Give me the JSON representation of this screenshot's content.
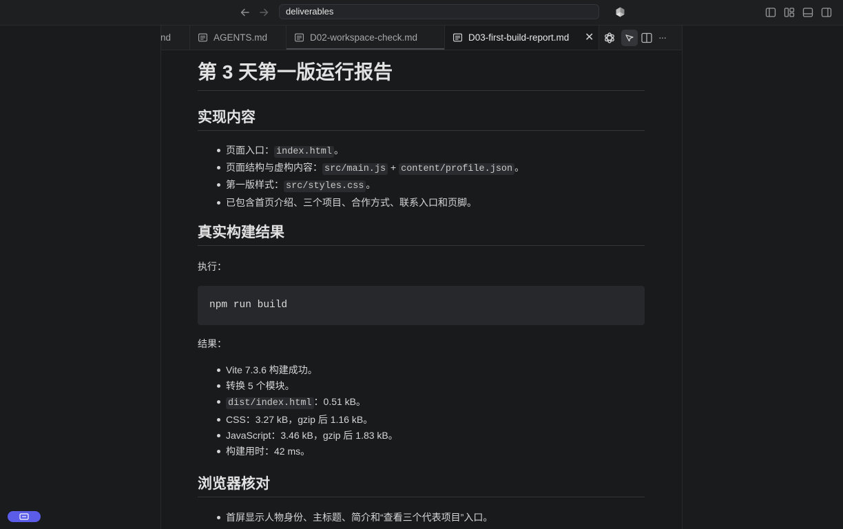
{
  "titlebar": {
    "address": "deliverables",
    "back_icon": "arrow-left-icon",
    "forward_icon": "arrow-right-icon",
    "logo_icon": "app-logo-icon",
    "layout_icons": [
      "sidebar-left-icon",
      "layout-grid-icon",
      "panel-bottom-icon",
      "sidebar-right-icon"
    ]
  },
  "tabs": [
    {
      "label": "nd",
      "active": false
    },
    {
      "label": "AGENTS.md",
      "active": false
    },
    {
      "label": "D02-workspace-check.md",
      "active": false
    },
    {
      "label": "D03-first-build-report.md",
      "active": true
    }
  ],
  "tab_close_glyph": "✕",
  "toolbar": {
    "more_glyph": "···",
    "icons": [
      "openai-icon",
      "pointer-icon",
      "split-editor-icon",
      "more-icon"
    ]
  },
  "doc": {
    "title": "第 3 天第一版运行报告",
    "section1": {
      "heading": "实现内容",
      "items": [
        {
          "pre": "页面入口：",
          "code1": "index.html",
          "mid": "",
          "code2": "",
          "post": "。"
        },
        {
          "pre": "页面结构与虚构内容：",
          "code1": "src/main.js",
          "mid": " + ",
          "code2": "content/profile.json",
          "post": "。"
        },
        {
          "pre": "第一版样式：",
          "code1": "src/styles.css",
          "mid": "",
          "code2": "",
          "post": "。"
        },
        {
          "pre": "已包含首页介绍、三个项目、合作方式、联系入口和页脚。",
          "code1": "",
          "mid": "",
          "code2": "",
          "post": ""
        }
      ]
    },
    "section2": {
      "heading": "真实构建结果",
      "exec_label": "执行：",
      "command": "npm run build",
      "result_label": "结果：",
      "items": [
        {
          "pre": "Vite 7.3.6 构建成功。",
          "code1": "",
          "post": ""
        },
        {
          "pre": "转换 5 个模块。",
          "code1": "",
          "post": ""
        },
        {
          "pre": "",
          "code1": "dist/index.html",
          "post": "：0.51 kB。"
        },
        {
          "pre": "CSS：3.27 kB，gzip 后 1.16 kB。",
          "code1": "",
          "post": ""
        },
        {
          "pre": "JavaScript：3.46 kB，gzip 后 1.83 kB。",
          "code1": "",
          "post": ""
        },
        {
          "pre": "构建用时：42 ms。",
          "code1": "",
          "post": ""
        }
      ]
    },
    "section3": {
      "heading": "浏览器核对",
      "items": [
        {
          "pre": "首屏显示人物身份、主标题、简介和“查看三个代表项目”入口。",
          "code1": "",
          "post": ""
        }
      ]
    }
  },
  "colors": {
    "background": "#191a1c",
    "accent": "#5b5ce8"
  }
}
